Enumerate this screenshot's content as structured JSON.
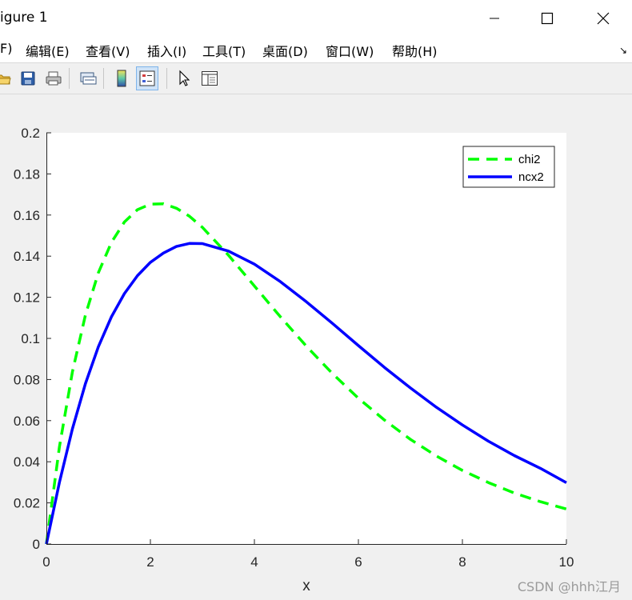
{
  "window": {
    "title": "igure 1",
    "controls": [
      "minimize",
      "maximize",
      "close"
    ]
  },
  "menubar": {
    "items": [
      {
        "label": "F)"
      },
      {
        "label": "编辑(E)"
      },
      {
        "label": "查看(V)"
      },
      {
        "label": "插入(I)"
      },
      {
        "label": "工具(T)"
      },
      {
        "label": "桌面(D)"
      },
      {
        "label": "窗口(W)"
      },
      {
        "label": "帮助(H)"
      }
    ],
    "dock_arrow": "↘"
  },
  "toolbar": {
    "buttons": [
      {
        "icon": "open-folder-icon"
      },
      {
        "icon": "save-icon"
      },
      {
        "icon": "print-icon"
      },
      {
        "icon": "link-plot-icon"
      },
      {
        "icon": "colorbar-icon"
      },
      {
        "icon": "legend-icon",
        "active": true
      },
      {
        "icon": "pointer-icon"
      },
      {
        "icon": "property-editor-icon"
      }
    ]
  },
  "chart_data": {
    "type": "line",
    "title": "",
    "xlabel": "x",
    "ylabel": "",
    "xlim": [
      0,
      10
    ],
    "ylim": [
      0,
      0.2
    ],
    "xticks": [
      "0",
      "2",
      "4",
      "6",
      "8",
      "10"
    ],
    "yticks": [
      "0",
      "0.02",
      "0.04",
      "0.06",
      "0.08",
      "0.1",
      "0.12",
      "0.14",
      "0.16",
      "0.18",
      "0.2"
    ],
    "legend_position": "top-right",
    "grid": false,
    "series": [
      {
        "name": "chi2",
        "style": "dashed",
        "color": "#00ff00",
        "x": [
          0,
          0.25,
          0.5,
          0.75,
          1,
          1.25,
          1.5,
          1.75,
          2,
          2.25,
          2.5,
          2.75,
          3,
          3.5,
          4,
          4.5,
          5,
          5.5,
          6,
          6.5,
          7,
          7.5,
          8,
          8.5,
          9,
          9.5,
          10
        ],
        "y": [
          0,
          0.0473,
          0.0837,
          0.1114,
          0.132,
          0.1467,
          0.1566,
          0.1626,
          0.1653,
          0.1655,
          0.1633,
          0.1594,
          0.154,
          0.1405,
          0.1255,
          0.1105,
          0.0962,
          0.0829,
          0.0709,
          0.0603,
          0.0509,
          0.0428,
          0.0358,
          0.0299,
          0.0248,
          0.0206,
          0.017
        ]
      },
      {
        "name": "ncx2",
        "style": "solid",
        "color": "#0000ff",
        "x": [
          0,
          0.25,
          0.5,
          0.75,
          1,
          1.25,
          1.5,
          1.75,
          2,
          2.25,
          2.5,
          2.75,
          3,
          3.5,
          4,
          4.5,
          5,
          5.5,
          6,
          6.5,
          7,
          7.5,
          8,
          8.5,
          9,
          9.5,
          10
        ],
        "y": [
          0,
          0.03,
          0.056,
          0.078,
          0.096,
          0.1105,
          0.1218,
          0.1305,
          0.137,
          0.1415,
          0.1447,
          0.1462,
          0.1461,
          0.1425,
          0.1361,
          0.1276,
          0.1178,
          0.1073,
          0.0965,
          0.0859,
          0.0759,
          0.0665,
          0.0579,
          0.05,
          0.043,
          0.0368,
          0.0298
        ]
      }
    ]
  },
  "watermark": "CSDN @hhh江月"
}
